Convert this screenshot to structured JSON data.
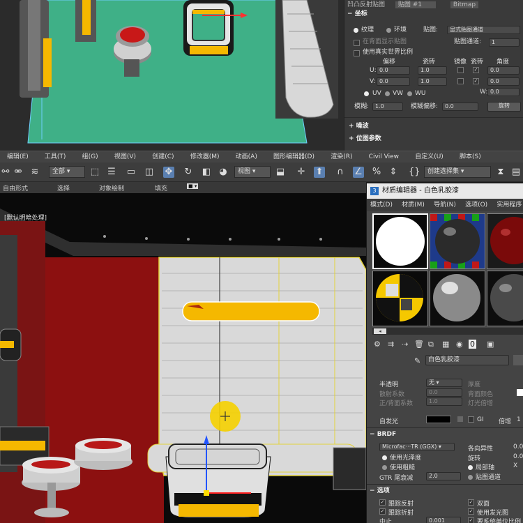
{
  "top_panel": {
    "header": "凹凸反射贴图",
    "header_map": "贴图 #1",
    "header_right": "Bitmap",
    "section_coords": "坐标",
    "radio_texture": "纹理",
    "radio_environ": "环境",
    "map_label": "贴图:",
    "map_value": "显式贴图通道",
    "show_back": "在背面显示贴图",
    "map_channel_label": "贴图通道:",
    "map_channel_value": "1",
    "real_world": "使用真实世界比例",
    "col_offset": "偏移",
    "col_tiling": "瓷砖",
    "col_mirror": "镜像",
    "col_tile": "瓷砖",
    "col_angle": "角度",
    "u_label": "U:",
    "v_label": "V:",
    "w_label": "W:",
    "u_offset": "0.0",
    "u_tiling": "1.0",
    "u_angle": "0.0",
    "v_offset": "0.0",
    "v_tiling": "1.0",
    "v_angle": "0.0",
    "w_angle": "0.0",
    "uv": "UV",
    "vw": "VW",
    "wu": "WU",
    "blur_label": "模糊:",
    "blur_value": "1.0",
    "blur_offset_label": "模糊偏移:",
    "blur_offset_value": "0.0",
    "rotate_btn": "旋转",
    "noise": "噪波",
    "bitmap_params": "位图参数"
  },
  "menubar": [
    "编辑(E)",
    "工具(T)",
    "组(G)",
    "视图(V)",
    "创建(C)",
    "修改器(M)",
    "动画(A)",
    "图形编辑器(D)",
    "渲染(R)",
    "Civil View",
    "自定义(U)",
    "脚本(S)"
  ],
  "toolbar": {
    "filter_dropdown": "全部",
    "view_dropdown": "视图",
    "selection_set": "创建选择集"
  },
  "ribbon": {
    "freeform": "自由形式",
    "select": "选择",
    "object_paint": "对象绘制",
    "populate": "填充"
  },
  "viewport": {
    "label": "[默认明暗处理]"
  },
  "material_editor": {
    "title": "材质编辑器 - 白色乳胶漆",
    "menu": [
      "模式(D)",
      "材质(M)",
      "导航(N)",
      "选项(O)",
      "实用程序"
    ],
    "material_name": "白色乳胶漆",
    "translucency_label": "半透明",
    "translucency_value": "无",
    "thickness_label": "厚度",
    "scatter_label": "散射系数",
    "scatter_value": "0.0",
    "back_color_label": "背面颜色",
    "fb_label": "正/背面系数",
    "fb_value": "1.0",
    "light_mult_label": "灯光倍增",
    "self_illum_label": "自发光",
    "gi_label": "GI",
    "multiplier_label": "倍增",
    "multiplier_value": "1",
    "brdf_title": "BRDF",
    "brdf_type": "Microfac···TR (GGX)",
    "anisotropy_label": "各向异性",
    "anisotropy_value": "0.0",
    "use_gloss": "使用光泽度",
    "use_rough": "使用粗糙",
    "rotation_label": "旋转",
    "rotation_value": "0.0",
    "local_axis": "局部轴",
    "axis_x": "X",
    "gtr_label": "GTR 尾衰减",
    "gtr_value": "2.0",
    "map_channel": "贴图通道",
    "options_title": "选项",
    "trace_reflect": "跟踪反射",
    "double_sided": "双面",
    "trace_refract": "跟踪折射",
    "use_glow": "使用发光图",
    "cutoff_label": "中止",
    "cutoff_value": "0.001",
    "unit_scale": "要系统单位比例"
  }
}
